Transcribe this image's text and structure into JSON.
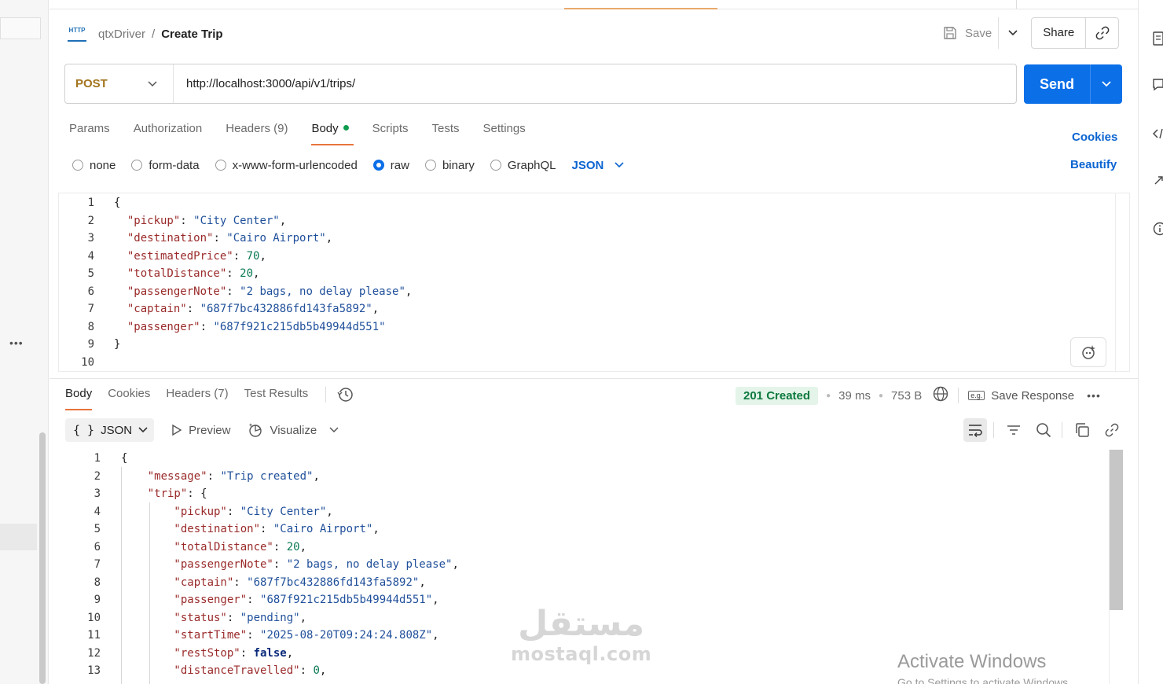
{
  "breadcrumb": {
    "collection": "qtxDriver",
    "separator": "/",
    "request": "Create Trip"
  },
  "header_actions": {
    "save_label": "Save",
    "share_label": "Share"
  },
  "request": {
    "method": "POST",
    "url": "http://localhost:3000/api/v1/trips/",
    "send_label": "Send",
    "tabs": [
      {
        "label": "Params"
      },
      {
        "label": "Authorization"
      },
      {
        "label": "Headers (9)"
      },
      {
        "label": "Body"
      },
      {
        "label": "Scripts"
      },
      {
        "label": "Tests"
      },
      {
        "label": "Settings"
      }
    ],
    "cookies_label": "Cookies",
    "beautify_label": "Beautify",
    "body_types": [
      "none",
      "form-data",
      "x-www-form-urlencoded",
      "raw",
      "binary",
      "GraphQL"
    ],
    "selected_body_type": "raw",
    "body_format": "JSON",
    "line_numbers": [
      "1",
      "2",
      "3",
      "4",
      "5",
      "6",
      "7",
      "8",
      "9",
      "10"
    ],
    "body_lines": [
      [
        [
          "p",
          "{"
        ]
      ],
      [
        [
          "k",
          "  \"pickup\""
        ],
        [
          "p",
          ": "
        ],
        [
          "s",
          "\"City Center\""
        ],
        [
          "p",
          ","
        ]
      ],
      [
        [
          "k",
          "  \"destination\""
        ],
        [
          "p",
          ": "
        ],
        [
          "s",
          "\"Cairo Airport\""
        ],
        [
          "p",
          ","
        ]
      ],
      [
        [
          "k",
          "  \"estimatedPrice\""
        ],
        [
          "p",
          ": "
        ],
        [
          "n",
          "70"
        ],
        [
          "p",
          ","
        ]
      ],
      [
        [
          "k",
          "  \"totalDistance\""
        ],
        [
          "p",
          ": "
        ],
        [
          "n",
          "20"
        ],
        [
          "p",
          ","
        ]
      ],
      [
        [
          "k",
          "  \"passengerNote\""
        ],
        [
          "p",
          ": "
        ],
        [
          "s",
          "\"2 bags, no delay please\""
        ],
        [
          "p",
          ","
        ]
      ],
      [
        [
          "k",
          "  \"captain\""
        ],
        [
          "p",
          ": "
        ],
        [
          "s",
          "\"687f7bc432886fd143fa5892\""
        ],
        [
          "p",
          ","
        ]
      ],
      [
        [
          "k",
          "  \"passenger\""
        ],
        [
          "p",
          ": "
        ],
        [
          "s",
          "\"687f921c215db5b49944d551\""
        ]
      ],
      [
        [
          "p",
          "}"
        ]
      ],
      []
    ]
  },
  "response": {
    "tabs": [
      {
        "label": "Body"
      },
      {
        "label": "Cookies"
      },
      {
        "label": "Headers (7)"
      },
      {
        "label": "Test Results"
      }
    ],
    "status": "201 Created",
    "time": "39 ms",
    "size": "753 B",
    "save_response_label": "Save Response",
    "save_response_icon_text": "e.g.",
    "format_label": "JSON",
    "format_braces": "{ }",
    "preview_label": "Preview",
    "visualize_label": "Visualize",
    "line_numbers": [
      "1",
      "2",
      "3",
      "4",
      "5",
      "6",
      "7",
      "8",
      "9",
      "10",
      "11",
      "12",
      "13"
    ],
    "body_lines": [
      [
        [
          "p",
          "{"
        ]
      ],
      [
        [
          "k",
          "    \"message\""
        ],
        [
          "p",
          ": "
        ],
        [
          "s",
          "\"Trip created\""
        ],
        [
          "p",
          ","
        ]
      ],
      [
        [
          "k",
          "    \"trip\""
        ],
        [
          "p",
          ": {"
        ]
      ],
      [
        [
          "k",
          "        \"pickup\""
        ],
        [
          "p",
          ": "
        ],
        [
          "s",
          "\"City Center\""
        ],
        [
          "p",
          ","
        ]
      ],
      [
        [
          "k",
          "        \"destination\""
        ],
        [
          "p",
          ": "
        ],
        [
          "s",
          "\"Cairo Airport\""
        ],
        [
          "p",
          ","
        ]
      ],
      [
        [
          "k",
          "        \"totalDistance\""
        ],
        [
          "p",
          ": "
        ],
        [
          "n",
          "20"
        ],
        [
          "p",
          ","
        ]
      ],
      [
        [
          "k",
          "        \"passengerNote\""
        ],
        [
          "p",
          ": "
        ],
        [
          "s",
          "\"2 bags, no delay please\""
        ],
        [
          "p",
          ","
        ]
      ],
      [
        [
          "k",
          "        \"captain\""
        ],
        [
          "p",
          ": "
        ],
        [
          "s",
          "\"687f7bc432886fd143fa5892\""
        ],
        [
          "p",
          ","
        ]
      ],
      [
        [
          "k",
          "        \"passenger\""
        ],
        [
          "p",
          ": "
        ],
        [
          "s",
          "\"687f921c215db5b49944d551\""
        ],
        [
          "p",
          ","
        ]
      ],
      [
        [
          "k",
          "        \"status\""
        ],
        [
          "p",
          ": "
        ],
        [
          "s",
          "\"pending\""
        ],
        [
          "p",
          ","
        ]
      ],
      [
        [
          "k",
          "        \"startTime\""
        ],
        [
          "p",
          ": "
        ],
        [
          "s",
          "\"2025-08-20T09:24:24.808Z\""
        ],
        [
          "p",
          ","
        ]
      ],
      [
        [
          "k",
          "        \"restStop\""
        ],
        [
          "p",
          ": "
        ],
        [
          "b",
          "false"
        ],
        [
          "p",
          ","
        ]
      ],
      [
        [
          "k",
          "        \"distanceTravelled\""
        ],
        [
          "p",
          ": "
        ],
        [
          "n",
          "0"
        ],
        [
          "p",
          ","
        ]
      ]
    ]
  },
  "watermark": {
    "arabic": "مستقل",
    "latin": "mostaql.com"
  },
  "os_notice": {
    "title": "Activate Windows",
    "subtitle": "Go to Settings to activate Windows."
  },
  "colors": {
    "accent": "#0b6fe8",
    "tab_underline": "#e8743b",
    "method_post": "#a3741d",
    "status_ok": "#0d7a3f"
  }
}
